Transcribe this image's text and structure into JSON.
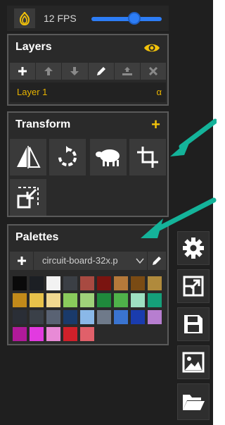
{
  "topbar": {
    "fps_label": "12 FPS",
    "fps_slider_fraction": 0.6
  },
  "layers": {
    "title": "Layers",
    "toolbar": [
      "add-icon",
      "move-up-icon",
      "move-down-icon",
      "edit-icon",
      "merge-down-icon",
      "delete-icon"
    ],
    "items": [
      {
        "name": "Layer 1",
        "alpha": "α"
      }
    ]
  },
  "transform": {
    "title": "Transform",
    "tools": [
      "flip-icon",
      "rotate-icon",
      "sheep-icon",
      "crop-icon",
      "resize-icon"
    ]
  },
  "palettes": {
    "title": "Palettes",
    "selected": "circuit-board-32x.p",
    "swatches": [
      "#0a0a0a",
      "#1c1f24",
      "#f2f2f2",
      "#3b3f45",
      "#a84a41",
      "#7a1410",
      "#b5793a",
      "#7a4b14",
      "#b08a3c",
      "#c28a1a",
      "#e8c24a",
      "#f0d890",
      "#8acb5c",
      "#9fd27a",
      "#1f8a3c",
      "#4fb24a",
      "#9de0c2",
      "#15a07a",
      "#2a2e36",
      "#3a4048",
      "#596273",
      "#1a3a6a",
      "#8ab8e8",
      "#6f7a8a",
      "#3a74d0",
      "#1a3cae",
      "#b77ed0",
      "#b01a9a",
      "#e23ae0",
      "#e88ad6",
      "#d0202a",
      "#e0606a"
    ]
  },
  "sidebar": [
    "gear-icon",
    "resize-canvas-icon",
    "save-icon",
    "image-icon",
    "open-folder-icon"
  ],
  "colors": {
    "accent": "#f2c20a",
    "teal_arrow": "#14b39a",
    "slider": "#2d7df6"
  }
}
